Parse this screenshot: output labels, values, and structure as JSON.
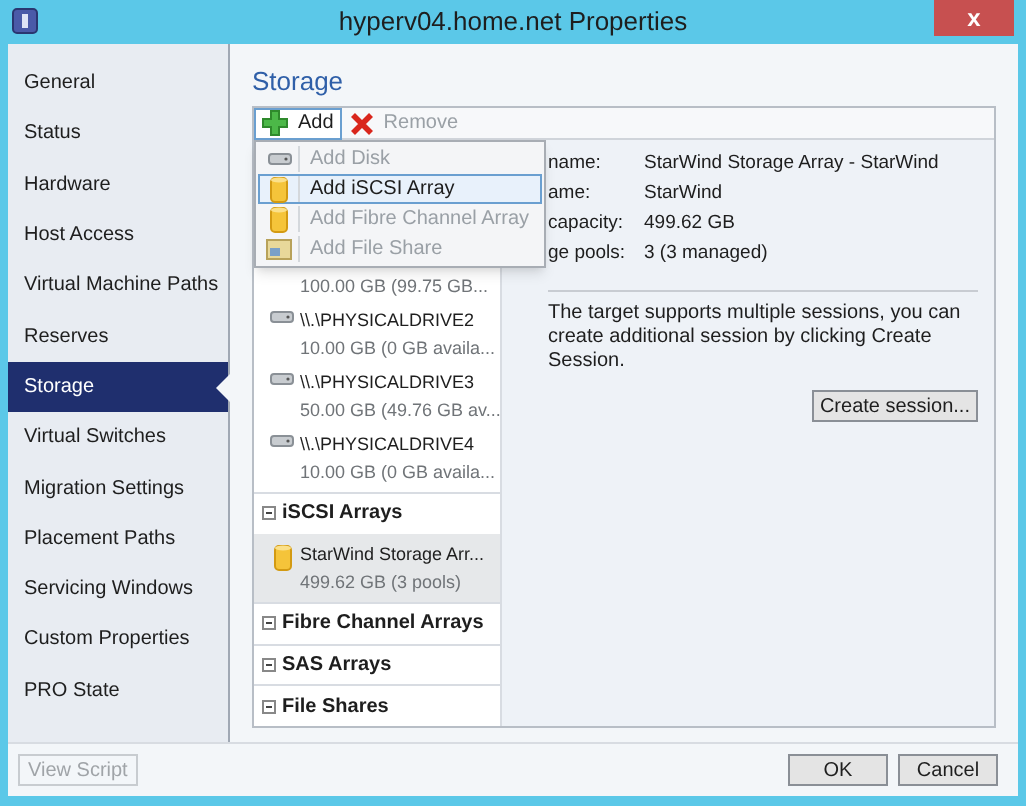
{
  "window": {
    "title": "hyperv04.home.net Properties",
    "close": "x"
  },
  "sidebar": {
    "items": [
      {
        "label": "General",
        "selected": false
      },
      {
        "label": "Status",
        "selected": false
      },
      {
        "label": "Hardware",
        "selected": false
      },
      {
        "label": "Host Access",
        "selected": false
      },
      {
        "label": "Virtual Machine Paths",
        "selected": false
      },
      {
        "label": "Reserves",
        "selected": false
      },
      {
        "label": "Storage",
        "selected": true
      },
      {
        "label": "Virtual Switches",
        "selected": false
      },
      {
        "label": "Migration Settings",
        "selected": false
      },
      {
        "label": "Placement Paths",
        "selected": false
      },
      {
        "label": "Servicing Windows",
        "selected": false
      },
      {
        "label": "Custom Properties",
        "selected": false
      },
      {
        "label": "PRO State",
        "selected": false
      }
    ]
  },
  "heading": "Storage",
  "toolbar": [
    {
      "label": "Add",
      "kind": "add",
      "disabled": false
    },
    {
      "label": "Remove",
      "kind": "remove",
      "disabled": true
    }
  ],
  "add_menu": [
    {
      "label": "Add Disk",
      "kind": "disk",
      "disabled": true,
      "selected": false
    },
    {
      "label": "Add iSCSI Array",
      "kind": "array",
      "disabled": false,
      "selected": true
    },
    {
      "label": "Add Fibre Channel Array",
      "kind": "array",
      "disabled": true,
      "selected": false
    },
    {
      "label": "Add File Share",
      "kind": "share",
      "disabled": true,
      "selected": false
    }
  ],
  "tree": [
    {
      "kind": "disk",
      "detail": "100.00 GB (99.75 GB...",
      "selected": false
    },
    {
      "kind": "disk",
      "name": "\\\\.\\PHYSICALDRIVE2",
      "detail": "10.00 GB (0 GB availa...",
      "selected": false
    },
    {
      "kind": "disk",
      "name": "\\\\.\\PHYSICALDRIVE3",
      "detail": "50.00 GB (49.76 GB av...",
      "selected": false
    },
    {
      "kind": "disk",
      "name": "\\\\.\\PHYSICALDRIVE4",
      "detail": "10.00 GB (0 GB availa...",
      "selected": false
    },
    {
      "kind": "group",
      "name": "iSCSI Arrays",
      "expanded": true
    },
    {
      "kind": "array",
      "name": "StarWind Storage Arr...",
      "detail": "499.62 GB (3 pools)",
      "selected": true
    },
    {
      "kind": "group",
      "name": "Fibre Channel Arrays",
      "expanded": true
    },
    {
      "kind": "group",
      "name": "SAS Arrays",
      "expanded": true
    },
    {
      "kind": "group",
      "name": "File Shares",
      "expanded": true
    }
  ],
  "details": [
    {
      "label": "name:",
      "value": "StarWind Storage Array - StarWind"
    },
    {
      "label": "ame:",
      "value": "StarWind"
    },
    {
      "label": "capacity:",
      "value": "499.62 GB"
    },
    {
      "label": "ge pools:",
      "value": "3 (3 managed)"
    }
  ],
  "session_note": "The target supports multiple sessions, you can create additional session by clicking Create Session.",
  "create_session": "Create session...",
  "footer": {
    "view_script": "View Script",
    "ok": "OK",
    "cancel": "Cancel"
  }
}
